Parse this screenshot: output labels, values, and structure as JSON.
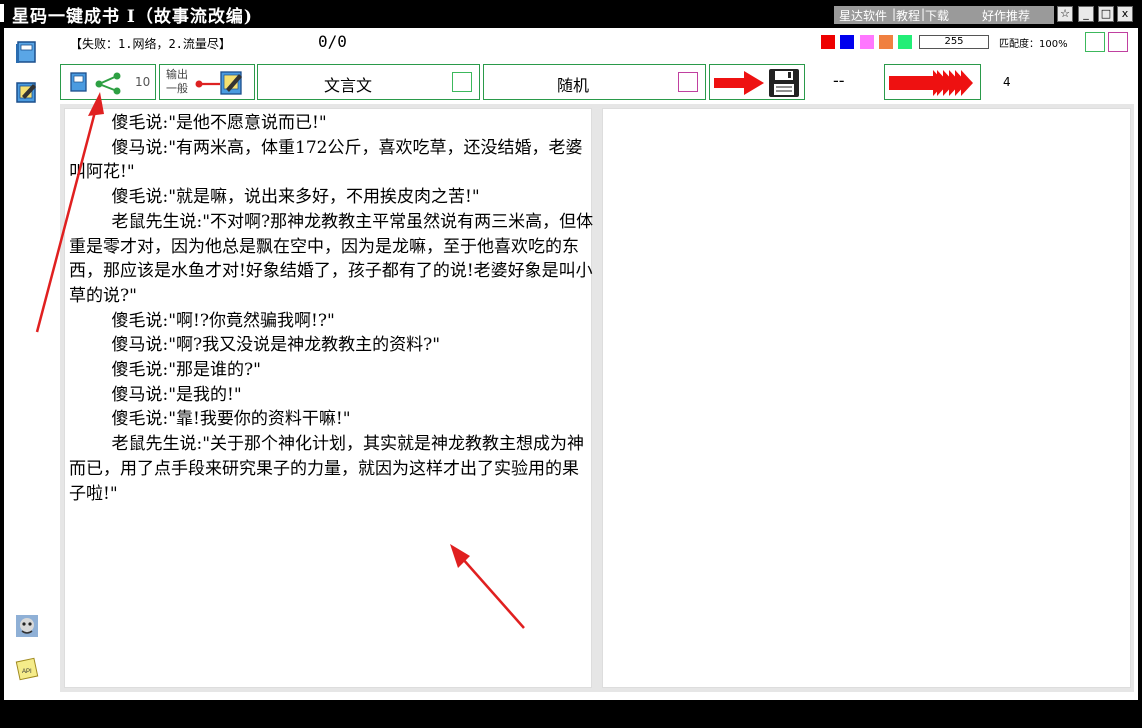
{
  "window": {
    "title": "星码一键成书 I（故事流改编)",
    "menu": [
      "星达软件",
      "教程",
      "下载",
      "好作推荐"
    ],
    "controls": [
      "☆",
      "_",
      "□",
      "x"
    ]
  },
  "sidebar": {
    "icons": [
      "book-icon",
      "notebook-icon",
      "avatar-icon",
      "api-note-icon"
    ],
    "api_label": "API"
  },
  "toolbar": {
    "status": "【失败：1.网络，2.流量尽】",
    "counter": "0/0",
    "colors": [
      "#ee0000",
      "#0000ee",
      "#ff77ff",
      "#f08040",
      "#22ee77"
    ],
    "number_value": "255",
    "match_label": "匹配度：100%",
    "check_colors": [
      "#3cb85c",
      "#c040a0"
    ]
  },
  "tools": {
    "split_count": "10",
    "output_label_line1": "输出",
    "output_label_line2": "一般",
    "classical_label": "文言文",
    "random_label": "随机",
    "dash_text": "--",
    "batch_count": "4"
  },
  "content": {
    "paragraphs": [
      "傻毛说:\"是他不愿意说而已!\"",
      "傻马说:\"有两米高，体重172公斤，喜欢吃草，还没结婚，老婆叫阿花!\"",
      "傻毛说:\"就是嘛，说出来多好，不用挨皮肉之苦!\"",
      "老鼠先生说:\"不对啊?那神龙教教主平常虽然说有两三米高，但体重是零才对，因为他总是飘在空中，因为是龙嘛，至于他喜欢吃的东西，那应该是水鱼才对!好象结婚了，孩子都有了的说!老婆好象是叫小草的说?\"",
      "傻毛说:\"啊!?你竟然骗我啊!?\"",
      "傻马说:\"啊?我又没说是神龙教教主的资料?\"",
      "傻毛说:\"那是谁的?\"",
      "傻马说:\"是我的!\"",
      "傻毛说:\"靠!我要你的资料干嘛!\"",
      "老鼠先生说:\"关于那个神化计划，其实就是神龙教教主想成为神而已，用了点手段来研究果子的力量，就因为这样才出了实验用的果子啦!\""
    ]
  }
}
